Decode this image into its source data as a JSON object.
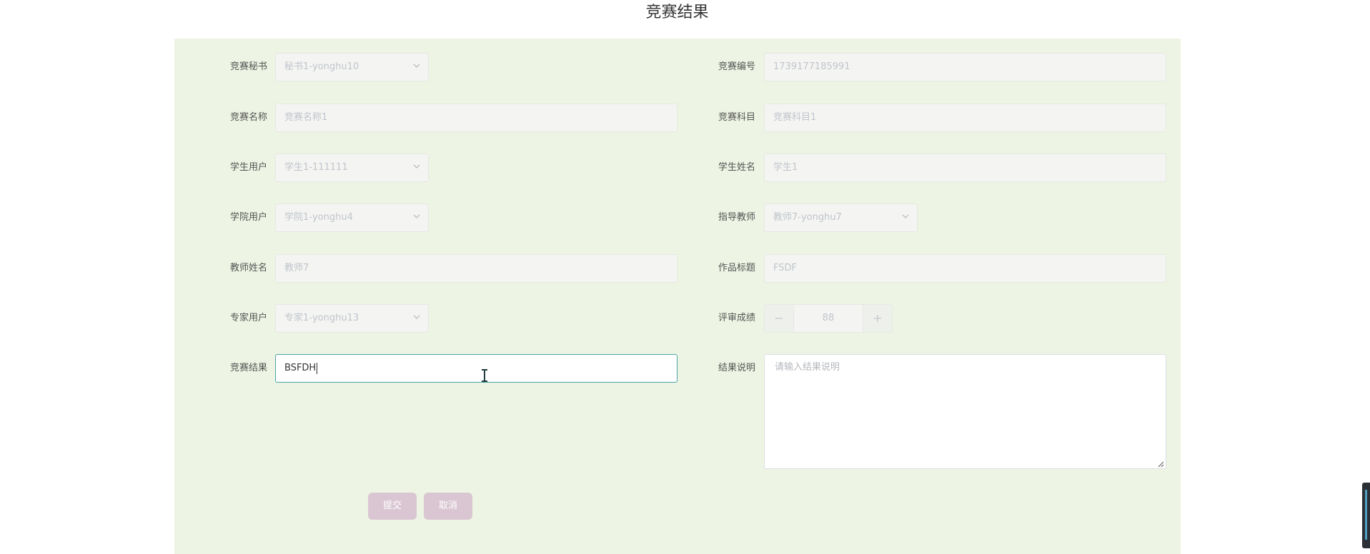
{
  "page": {
    "title": "竞赛结果"
  },
  "form": {
    "secretary": {
      "label": "竞赛秘书",
      "value": "秘书1-yonghu10"
    },
    "competition_no": {
      "label": "竞赛编号",
      "value": "1739177185991"
    },
    "competition_name": {
      "label": "竞赛名称",
      "value": "竞赛名称1"
    },
    "competition_subject": {
      "label": "竞赛科目",
      "value": "竞赛科目1"
    },
    "student_user": {
      "label": "学生用户",
      "value": "学生1-111111"
    },
    "student_name": {
      "label": "学生姓名",
      "value": "学生1"
    },
    "college_user": {
      "label": "学院用户",
      "value": "学院1-yonghu4"
    },
    "advisor": {
      "label": "指导教师",
      "value": "教师7-yonghu7"
    },
    "teacher_name": {
      "label": "教师姓名",
      "value": "教师7"
    },
    "work_title": {
      "label": "作品标题",
      "value": "FSDF"
    },
    "expert_user": {
      "label": "专家用户",
      "value": "专家1-yonghu13"
    },
    "review_score": {
      "label": "评审成绩",
      "value": "88",
      "minus": "−",
      "plus": "+"
    },
    "result": {
      "label": "竞赛结果",
      "value": "BSFDH"
    },
    "result_note": {
      "label": "结果说明",
      "placeholder": "请输入结果说明"
    }
  },
  "buttons": {
    "submit": "提交",
    "cancel": "取消"
  },
  "icons": {
    "dropdown": "chevron-down-icon"
  },
  "colors": {
    "panel_bg": "#edf4e3",
    "focus_border": "#4aa3a8",
    "button_bg": "#d9c6d2"
  }
}
